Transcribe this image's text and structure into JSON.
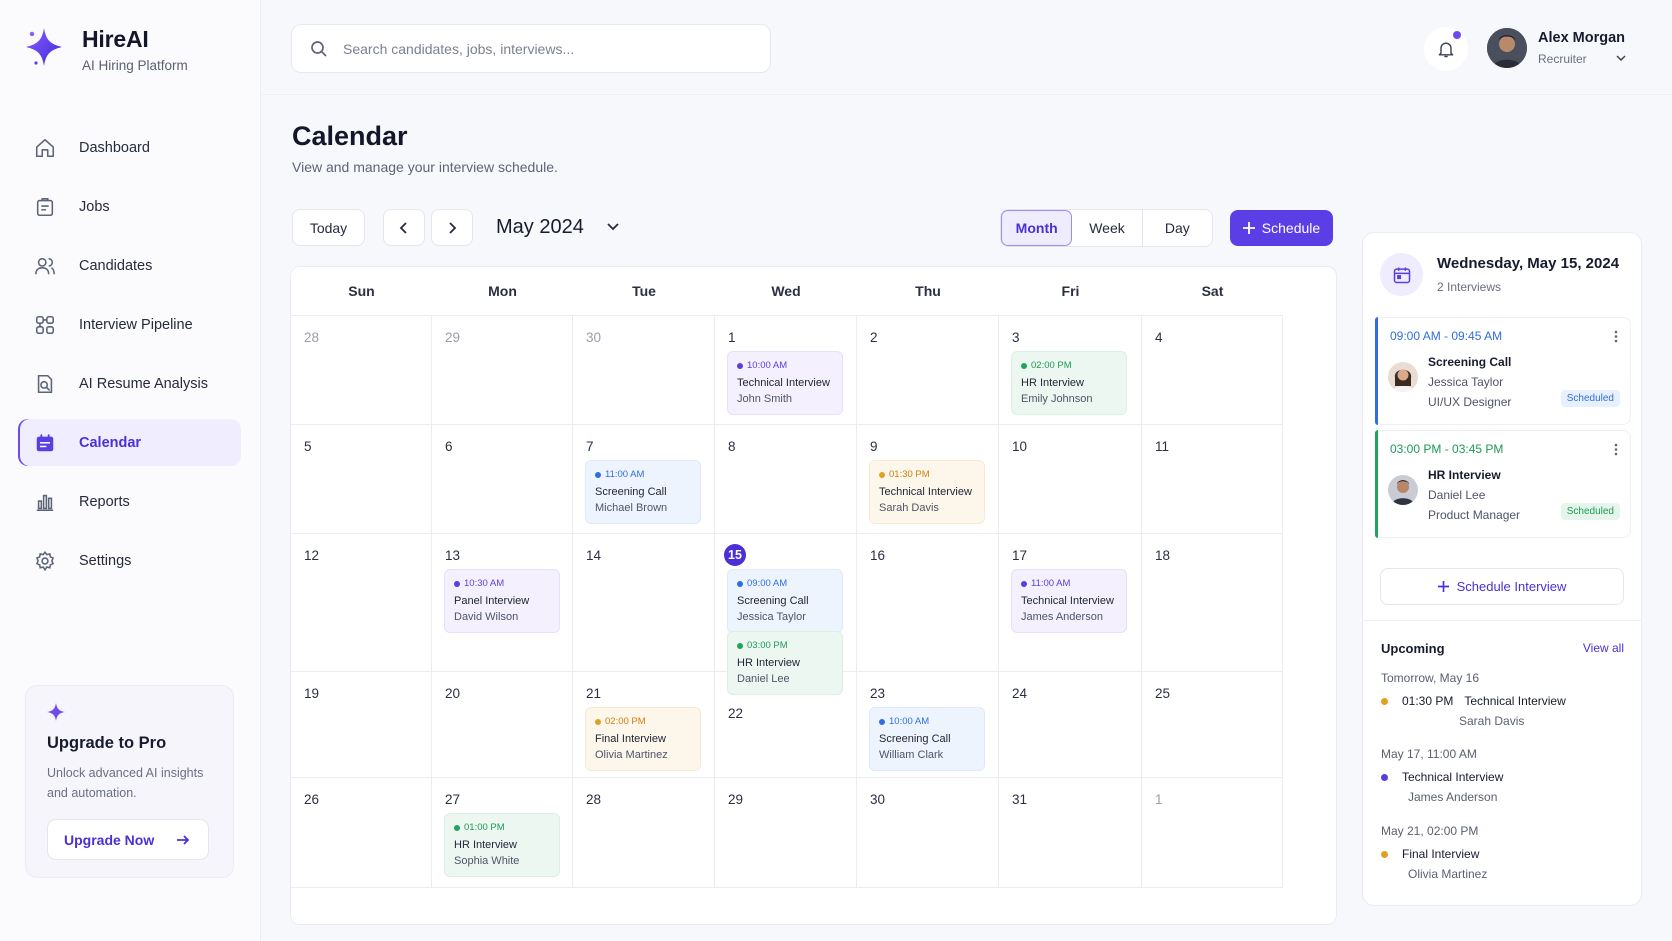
{
  "brand": {
    "name": "HireAI",
    "subtitle": "AI Hiring Platform"
  },
  "sidebar": {
    "items": [
      {
        "label": "Dashboard",
        "icon": "home-icon"
      },
      {
        "label": "Jobs",
        "icon": "briefcase-icon"
      },
      {
        "label": "Candidates",
        "icon": "users-icon"
      },
      {
        "label": "Interview Pipeline",
        "icon": "pipeline-icon"
      },
      {
        "label": "AI Resume Analysis",
        "icon": "resume-analysis-icon"
      },
      {
        "label": "Calendar",
        "icon": "calendar-icon",
        "active": true
      },
      {
        "label": "Reports",
        "icon": "bar-chart-icon"
      },
      {
        "label": "Settings",
        "icon": "gear-icon"
      }
    ],
    "upgrade": {
      "title": "Upgrade to Pro",
      "description": "Unlock advanced AI insights and automation.",
      "button": "Upgrade Now"
    }
  },
  "topbar": {
    "search_placeholder": "Search candidates, jobs, interviews...",
    "user": {
      "name": "Alex Morgan",
      "role": "Recruiter"
    }
  },
  "page": {
    "title": "Calendar",
    "subtitle": "View and manage your interview schedule."
  },
  "toolbar": {
    "today": "Today",
    "month": "May 2024",
    "views": [
      "Month",
      "Week",
      "Day"
    ],
    "active_view": "Month",
    "schedule": "Schedule"
  },
  "calendar": {
    "weekdays": [
      "Sun",
      "Mon",
      "Tue",
      "Wed",
      "Thu",
      "Fri",
      "Sat"
    ],
    "today": "15",
    "weeks": [
      [
        {
          "day": "28",
          "muted": true
        },
        {
          "day": "29",
          "muted": true
        },
        {
          "day": "30",
          "muted": true
        },
        {
          "day": "1",
          "events": [
            {
              "time": "10:00 AM",
              "title": "Technical Interview",
              "person": "John Smith",
              "color": "purple"
            }
          ]
        },
        {
          "day": "2"
        },
        {
          "day": "3",
          "events": [
            {
              "time": "02:00 PM",
              "title": "HR Interview",
              "person": "Emily Johnson",
              "color": "green"
            }
          ]
        },
        {
          "day": "4"
        }
      ],
      [
        {
          "day": "5"
        },
        {
          "day": "6"
        },
        {
          "day": "7",
          "events": [
            {
              "time": "11:00 AM",
              "title": "Screening Call",
              "person": "Michael Brown",
              "color": "blue"
            }
          ]
        },
        {
          "day": "8"
        },
        {
          "day": "9",
          "events": [
            {
              "time": "01:30 PM",
              "title": "Technical Interview",
              "person": "Sarah Davis",
              "color": "orange"
            }
          ]
        },
        {
          "day": "10"
        },
        {
          "day": "11"
        }
      ],
      [
        {
          "day": "12"
        },
        {
          "day": "13",
          "events": [
            {
              "time": "10:30 AM",
              "title": "Panel Interview",
              "person": "David Wilson",
              "color": "purple"
            }
          ]
        },
        {
          "day": "14"
        },
        {
          "day": "15",
          "events": [
            {
              "time": "09:00 AM",
              "title": "Screening Call",
              "person": "Jessica Taylor",
              "color": "blue"
            },
            {
              "time": "03:00 PM",
              "title": "HR Interview",
              "person": "Daniel Lee",
              "color": "green"
            }
          ]
        },
        {
          "day": "16"
        },
        {
          "day": "17",
          "events": [
            {
              "time": "11:00 AM",
              "title": "Technical Interview",
              "person": "James Anderson",
              "color": "purple"
            }
          ]
        },
        {
          "day": "18"
        }
      ],
      [
        {
          "day": "19"
        },
        {
          "day": "20"
        },
        {
          "day": "21",
          "events": [
            {
              "time": "02:00 PM",
              "title": "Final Interview",
              "person": "Olivia Martinez",
              "color": "orange"
            }
          ]
        },
        {
          "day": "22"
        },
        {
          "day": "23",
          "events": [
            {
              "time": "10:00 AM",
              "title": "Screening Call",
              "person": "William Clark",
              "color": "blue"
            }
          ]
        },
        {
          "day": "24"
        },
        {
          "day": "25"
        }
      ],
      [
        {
          "day": "26"
        },
        {
          "day": "27",
          "events": [
            {
              "time": "01:00 PM",
              "title": "HR Interview",
              "person": "Sophia White",
              "color": "green"
            }
          ]
        },
        {
          "day": "28"
        },
        {
          "day": "29"
        },
        {
          "day": "30"
        },
        {
          "day": "31"
        },
        {
          "day": "1",
          "muted": true
        }
      ]
    ]
  },
  "panel": {
    "date": "Wednesday, May 15, 2024",
    "count": "2 Interviews",
    "interviews": [
      {
        "time": "09:00 AM - 09:45 AM",
        "title": "Screening Call",
        "name": "Jessica Taylor",
        "role": "UI/UX Designer",
        "status": "Scheduled",
        "color": "#2f6ee0",
        "badge_bg": "#e8f0fd"
      },
      {
        "time": "03:00 PM - 03:45 PM",
        "title": "HR Interview",
        "name": "Daniel Lee",
        "role": "Product Manager",
        "status": "Scheduled",
        "color": "#1d9a55",
        "badge_bg": "#e6f5ec"
      }
    ],
    "schedule_interview": "Schedule Interview",
    "upcoming_title": "Upcoming",
    "view_all": "View all",
    "upcoming": [
      {
        "date": "Tomorrow, May 16",
        "time": "01:30 PM",
        "title": "Technical Interview",
        "person": "Sarah Davis",
        "color": "#e0a020"
      },
      {
        "date": "May 17, 11:00 AM",
        "time": "",
        "title": "Technical Interview",
        "person": "James Anderson",
        "color": "#5b3ee0"
      },
      {
        "date": "May 21, 02:00 PM",
        "time": "",
        "title": "Final Interview",
        "person": "Olivia Martinez",
        "color": "#e0a020"
      }
    ]
  },
  "colors": {
    "accent": "#5b3ee6",
    "today": "#4c2fd6"
  }
}
